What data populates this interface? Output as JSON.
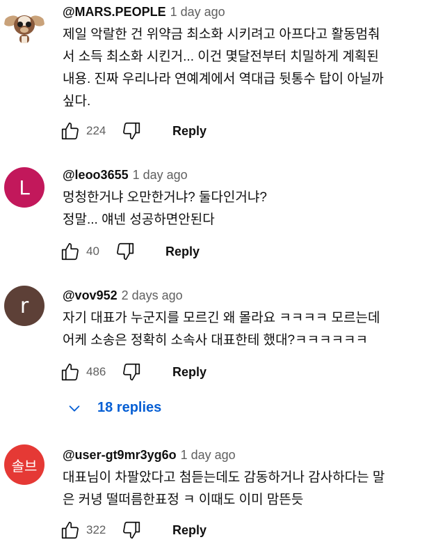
{
  "comments": [
    {
      "author": "@MARS.PEOPLE",
      "time": "1 day ago",
      "text": "제일 악랄한 건 위약금 최소화 시키려고 아프다고 활동멈춰\n서 소득 최소화 시킨거... 이건 몇달전부터 치밀하게 계획된\n내용. 진짜 우리나라 연예계에서 역대급 뒷통수 탑이 아닐까\n싶다.",
      "likes": "224",
      "reply_label": "Reply",
      "avatar_icon": "gremlin-character-avatar"
    },
    {
      "author": "@leoo3655",
      "time": "1 day ago",
      "text": "멍청한거냐 오만한거냐? 둘다인거냐?\n정말... 얘넨 성공하면안된다",
      "likes": "40",
      "reply_label": "Reply",
      "avatar_letter": "L",
      "avatar_color": "#c2185b"
    },
    {
      "author": "@vov952",
      "time": "2 days ago",
      "text": "자기 대표가 누군지를 모르긴 왜 몰라요 ㅋㅋㅋㅋ 모르는데\n어케 소송은 정확히 소속사 대표한테 했대?ㅋㅋㅋㅋㅋㅋ",
      "likes": "486",
      "reply_label": "Reply",
      "avatar_letter": "r",
      "avatar_color": "#5d4037",
      "replies_label": "18 replies"
    },
    {
      "author": "@user-gt9mr3yg6o",
      "time": "1 day ago",
      "text": "대표님이 차팔았다고 첨듣는데도 감동하거나 감사하다는 말\n은 커녕 떨떠름한표정 ㅋ 이때도 이미 맘뜬듯",
      "likes": "322",
      "reply_label": "Reply",
      "avatar_text": "솔브",
      "avatar_color": "#e53935"
    }
  ],
  "colors": {
    "link_blue": "#065fd4",
    "secondary_text": "#606060"
  }
}
